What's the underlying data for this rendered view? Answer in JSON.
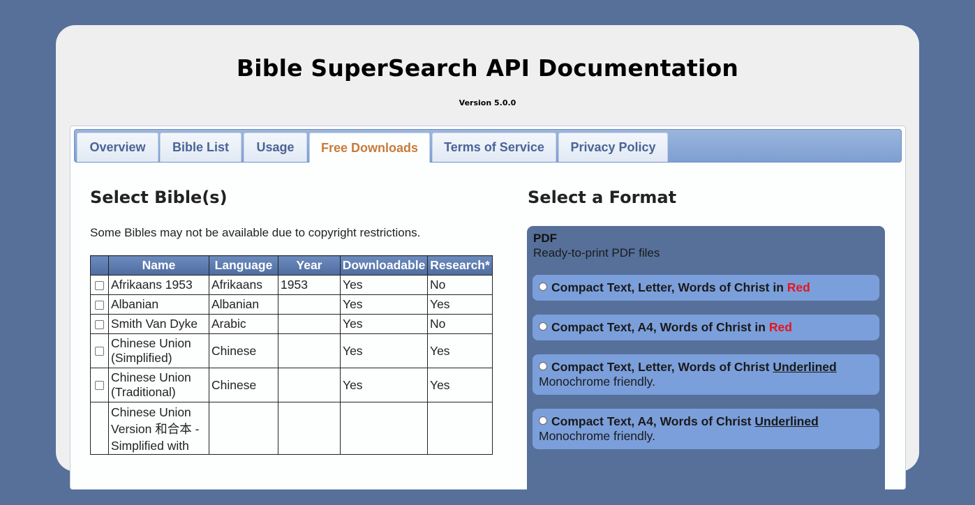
{
  "header": {
    "title": "Bible SuperSearch API Documentation",
    "version": "Version 5.0.0"
  },
  "tabs": [
    {
      "label": "Overview",
      "active": false
    },
    {
      "label": "Bible List",
      "active": false
    },
    {
      "label": "Usage",
      "active": false
    },
    {
      "label": "Free Downloads",
      "active": true
    },
    {
      "label": "Terms of Service",
      "active": false
    },
    {
      "label": "Privacy Policy",
      "active": false
    }
  ],
  "select_bibles": {
    "heading": "Select Bible(s)",
    "note": "Some Bibles may not be available due to copyright restrictions.",
    "columns": [
      "Name",
      "Language",
      "Year",
      "Downloadable",
      "Research*"
    ],
    "rows": [
      {
        "name": "Afrikaans 1953",
        "language": "Afrikaans",
        "year": "1953",
        "downloadable": "Yes",
        "research": "No"
      },
      {
        "name": "Albanian",
        "language": "Albanian",
        "year": "",
        "downloadable": "Yes",
        "research": "Yes"
      },
      {
        "name": "Smith Van Dyke",
        "language": "Arabic",
        "year": "",
        "downloadable": "Yes",
        "research": "No"
      },
      {
        "name": "Chinese Union (Simplified)",
        "language": "Chinese",
        "year": "",
        "downloadable": "Yes",
        "research": "Yes"
      },
      {
        "name": "Chinese Union (Traditional)",
        "language": "Chinese",
        "year": "",
        "downloadable": "Yes",
        "research": "Yes"
      },
      {
        "name": "Chinese Union Version 和合本 - Simplified with",
        "language": "",
        "year": "",
        "downloadable": "",
        "research": ""
      }
    ]
  },
  "select_format": {
    "heading": "Select a Format",
    "group_title": "PDF",
    "group_desc": "Ready-to-print PDF files",
    "options": [
      {
        "text": "Compact Text, Letter, Words of Christ",
        "join": "in",
        "em": "Red",
        "style": "red",
        "sub": ""
      },
      {
        "text": "Compact Text, A4, Words of Christ",
        "join": "in",
        "em": "Red",
        "style": "red",
        "sub": ""
      },
      {
        "text": "Compact Text, Letter, Words of Christ",
        "join": "",
        "em": "Underlined",
        "style": "underline",
        "sub": "Monochrome friendly."
      },
      {
        "text": "Compact Text, A4, Words of Christ",
        "join": "",
        "em": "Underlined",
        "style": "underline",
        "sub": "Monochrome friendly."
      }
    ]
  }
}
